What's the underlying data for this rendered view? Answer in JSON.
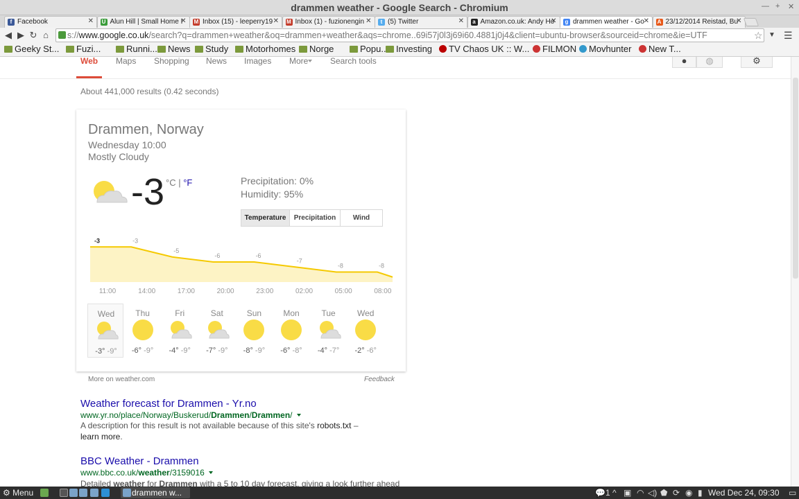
{
  "window": {
    "title": "drammen weather - Google Search - Chromium"
  },
  "tabs": [
    {
      "label": "Facebook",
      "color": "#3b5998",
      "glyph": "f"
    },
    {
      "label": "Alun Hill | Small Home I",
      "color": "#3a9c3a",
      "glyph": "U"
    },
    {
      "label": "Inbox (15) - leeperry19",
      "color": "#c43c2b",
      "glyph": "M"
    },
    {
      "label": "Inbox (1) - fuzionengin",
      "color": "#c43c2b",
      "glyph": "M"
    },
    {
      "label": "(5) Twitter",
      "color": "#55acee",
      "glyph": "t"
    },
    {
      "label": "Amazon.co.uk: Andy Ho",
      "color": "#222222",
      "glyph": "a"
    },
    {
      "label": "drammen weather - Go",
      "color": "#4285f4",
      "glyph": "g"
    },
    {
      "label": "23/12/2014 Reistad, Bu",
      "color": "#e8591a",
      "glyph": "A"
    }
  ],
  "omnibox": {
    "prefix": "s://",
    "host": "www.google.co.uk",
    "rest": "/search?q=drammen+weather&oq=drammen+weather&aqs=chrome..69i57j0l3j69i60.4881j0j4&client=ubuntu-browser&sourceid=chrome&ie=UTF"
  },
  "bookmarks": [
    {
      "label": "Geeky St...",
      "type": "folder"
    },
    {
      "label": "Fuzi...",
      "type": "folder"
    },
    {
      "label": "Runni...",
      "type": "folder"
    },
    {
      "label": "News",
      "type": "folder"
    },
    {
      "label": "Study",
      "type": "folder"
    },
    {
      "label": "Motorhomes",
      "type": "folder"
    },
    {
      "label": "Norge",
      "type": "folder"
    },
    {
      "label": "Popu...",
      "type": "folder"
    },
    {
      "label": "Investing",
      "type": "folder"
    },
    {
      "label": "TV Chaos UK :: W...",
      "type": "site"
    },
    {
      "label": "FILMON",
      "type": "site"
    },
    {
      "label": "Movhunter",
      "type": "site"
    },
    {
      "label": "New T...",
      "type": "site"
    }
  ],
  "google_nav": {
    "items": [
      "Web",
      "Maps",
      "Shopping",
      "News",
      "Images",
      "More",
      "Search tools"
    ]
  },
  "stats": "About 441,000 results (0.42 seconds)",
  "weather": {
    "location": "Drammen, Norway",
    "time": "Wednesday 10:00",
    "condition": "Mostly Cloudy",
    "temp": "-3",
    "unit_c": "°C",
    "unit_sep": "|",
    "unit_f": "°F",
    "precipitation": "Precipitation: 0%",
    "humidity": "Humidity: 95%",
    "tabs": [
      "Temperature",
      "Precipitation",
      "Wind"
    ],
    "more_link": "More on weather.com",
    "feedback": "Feedback",
    "days": [
      {
        "name": "Wed",
        "hi": "-3°",
        "lo": "-9°",
        "icon": "partly-cloudy-icon"
      },
      {
        "name": "Thu",
        "hi": "-6°",
        "lo": "-9°",
        "icon": "sun-icon"
      },
      {
        "name": "Fri",
        "hi": "-4°",
        "lo": "-9°",
        "icon": "partly-cloudy-icon"
      },
      {
        "name": "Sat",
        "hi": "-7°",
        "lo": "-9°",
        "icon": "partly-cloudy-icon"
      },
      {
        "name": "Sun",
        "hi": "-8°",
        "lo": "-9°",
        "icon": "sun-icon"
      },
      {
        "name": "Mon",
        "hi": "-6°",
        "lo": "-8°",
        "icon": "sun-icon"
      },
      {
        "name": "Tue",
        "hi": "-4°",
        "lo": "-7°",
        "icon": "partly-cloudy-icon"
      },
      {
        "name": "Wed",
        "hi": "-2°",
        "lo": "-6°",
        "icon": "sun-icon"
      }
    ]
  },
  "chart_data": {
    "type": "area",
    "x": [
      "11:00",
      "14:00",
      "17:00",
      "20:00",
      "23:00",
      "02:00",
      "05:00",
      "08:00"
    ],
    "values": [
      -3,
      -3,
      -5,
      -6,
      -6,
      -7,
      -8,
      -8
    ],
    "labels": [
      "-3",
      "-3",
      "-5",
      "-6",
      "-6",
      "-7",
      "-8",
      "-8"
    ],
    "ylim": [
      -10,
      -2
    ],
    "colors": {
      "line": "#f5c900",
      "fill": "#fdf3c5"
    }
  },
  "results": [
    {
      "title": "Weather forecast for Drammen - Yr.no",
      "url_pre": "www.yr.no/place/Norway/Buskerud/",
      "url_b1": "Drammen",
      "url_mid": "/",
      "url_b2": "Drammen",
      "url_post": "/",
      "snippet_1": "A description for this result is not available because of this site's ",
      "snippet_robots": "robots.txt",
      "snippet_2": " – ",
      "snippet_learn": "learn more",
      "snippet_end": "."
    },
    {
      "title": "BBC Weather - Drammen",
      "url_pre": "www.bbc.co.uk/",
      "url_b1": "weather",
      "url_post": "/3159016",
      "snippet_1": "Detailed ",
      "snippet_b1": "weather",
      "snippet_2": " for ",
      "snippet_b2": "Drammen",
      "snippet_3": " with a 5 to 10 day forecast, giving a look further ahead."
    }
  ],
  "taskbar": {
    "menu": "Menu",
    "task": "drammen w...",
    "clock": "Wed Dec 24, 09:30",
    "notification_count": "1"
  }
}
